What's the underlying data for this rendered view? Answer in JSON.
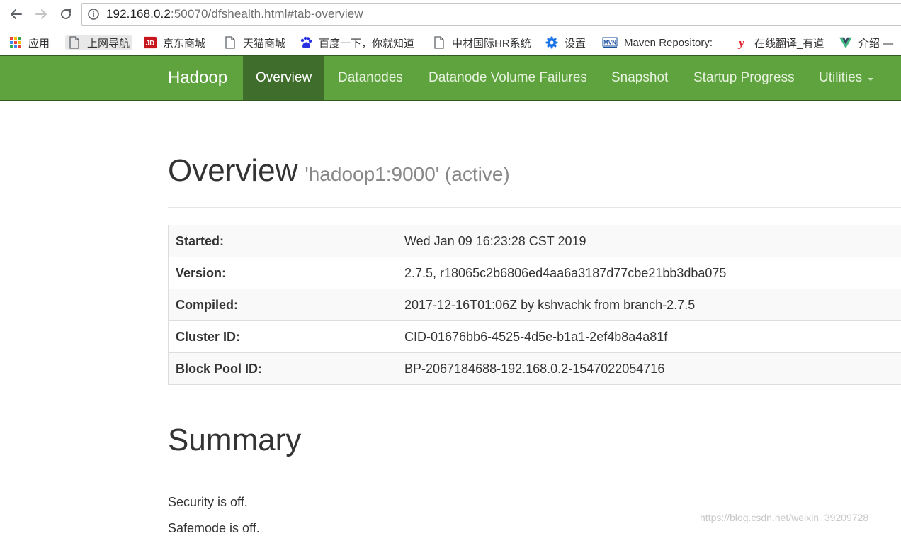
{
  "browser": {
    "url_host": "192.168.0.2",
    "url_rest": ":50070/dfshealth.html#tab-overview"
  },
  "bookmarks": [
    {
      "label": "应用",
      "icon": "apps-grid-icon"
    },
    {
      "label": "上网导航",
      "icon": "page-icon"
    },
    {
      "label": "京东商城",
      "icon": "jd-logo-icon"
    },
    {
      "label": "天猫商城",
      "icon": "page-icon"
    },
    {
      "label": "百度一下，你就知道",
      "icon": "baidu-paw-icon"
    },
    {
      "label": "中材国际HR系统",
      "icon": "page-icon"
    },
    {
      "label": "设置",
      "icon": "gear-icon"
    },
    {
      "label": "Maven Repository:",
      "icon": "mvn-logo-icon"
    },
    {
      "label": "在线翻译_有道",
      "icon": "youdao-logo-icon"
    },
    {
      "label": "介绍 —",
      "icon": "vue-logo-icon"
    }
  ],
  "navbar": {
    "brand": "Hadoop",
    "items": [
      {
        "label": "Overview",
        "active": true
      },
      {
        "label": "Datanodes"
      },
      {
        "label": "Datanode Volume Failures"
      },
      {
        "label": "Snapshot"
      },
      {
        "label": "Startup Progress"
      },
      {
        "label": "Utilities",
        "dropdown": true
      }
    ],
    "colors": {
      "bar": "#5fa33e",
      "active": "#3f6d2b"
    }
  },
  "overview": {
    "title": "Overview",
    "subtitle": "'hadoop1:9000' (active)",
    "rows": [
      {
        "key": "Started:",
        "value": "Wed Jan 09 16:23:28 CST 2019"
      },
      {
        "key": "Version:",
        "value": "2.7.5, r18065c2b6806ed4aa6a3187d77cbe21bb3dba075"
      },
      {
        "key": "Compiled:",
        "value": "2017-12-16T01:06Z by kshvachk from branch-2.7.5"
      },
      {
        "key": "Cluster ID:",
        "value": "CID-01676bb6-4525-4d5e-b1a1-2ef4b8a4a81f"
      },
      {
        "key": "Block Pool ID:",
        "value": "BP-2067184688-192.168.0.2-1547022054716"
      }
    ]
  },
  "summary": {
    "title": "Summary",
    "security": "Security is off.",
    "safemode": "Safemode is off."
  },
  "watermark": "https://blog.csdn.net/weixin_39209728"
}
